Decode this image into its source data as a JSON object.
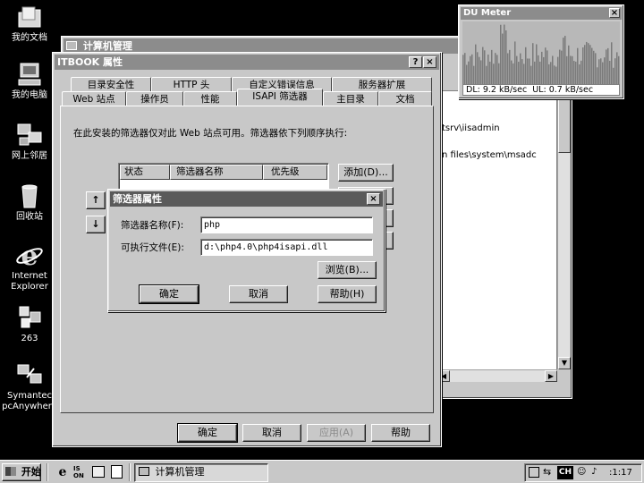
{
  "desktop": {
    "icons": [
      {
        "label": "我的文档"
      },
      {
        "label": "我的电脑"
      },
      {
        "label": "网上邻居"
      },
      {
        "label": "回收站"
      },
      {
        "label": "Internet",
        "label2": "Explorer"
      },
      {
        "label": "263"
      },
      {
        "label": "Symantec",
        "label2": "pcAnywhere"
      }
    ]
  },
  "mmc": {
    "title": "计算机管理",
    "right_text_1": "tsrv\\iisadmin",
    "right_text_2": "n files\\system\\msadc"
  },
  "dumeter": {
    "title": "DU Meter",
    "close": "×",
    "readout": "DL: 9.2 kB/sec  UL: 0.7 kB/sec",
    "colors": {
      "graph_bg": "#b8b8b8",
      "graph_fg": "#7a7a7a"
    }
  },
  "props": {
    "title": "ITBOOK 属性",
    "help_btn": "?",
    "close_btn": "×",
    "tabs_row1": [
      "目录安全性",
      "HTTP 头",
      "自定义错误信息",
      "服务器扩展"
    ],
    "tabs_row2": [
      "Web 站点",
      "操作员",
      "性能",
      "ISAPI 筛选器",
      "主目录",
      "文档"
    ],
    "active_tab": "ISAPI 筛选器",
    "description": "在此安装的筛选器仅对此 Web 站点可用。筛选器依下列顺序执行:",
    "columns": [
      "状态",
      "筛选器名称",
      "优先级"
    ],
    "add_btn": "添加(D)...",
    "up_arrow": "↑",
    "down_arrow": "↓",
    "ok": "确定",
    "cancel": "取消",
    "apply": "应用(A)",
    "help": "帮助"
  },
  "filter_dialog": {
    "title": "筛选器属性",
    "close": "×",
    "name_label": "筛选器名称(F):",
    "name_value": "php",
    "exe_label": "可执行文件(E):",
    "exe_value": "d:\\php4.0\\php4isapi.dll",
    "browse": "浏览(B)...",
    "ok": "确定",
    "cancel": "取消",
    "help": "帮助(H)"
  },
  "taskbar": {
    "start": "开始",
    "task_label": "计算机管理",
    "ime": "CH",
    "clock": ":1:17"
  }
}
